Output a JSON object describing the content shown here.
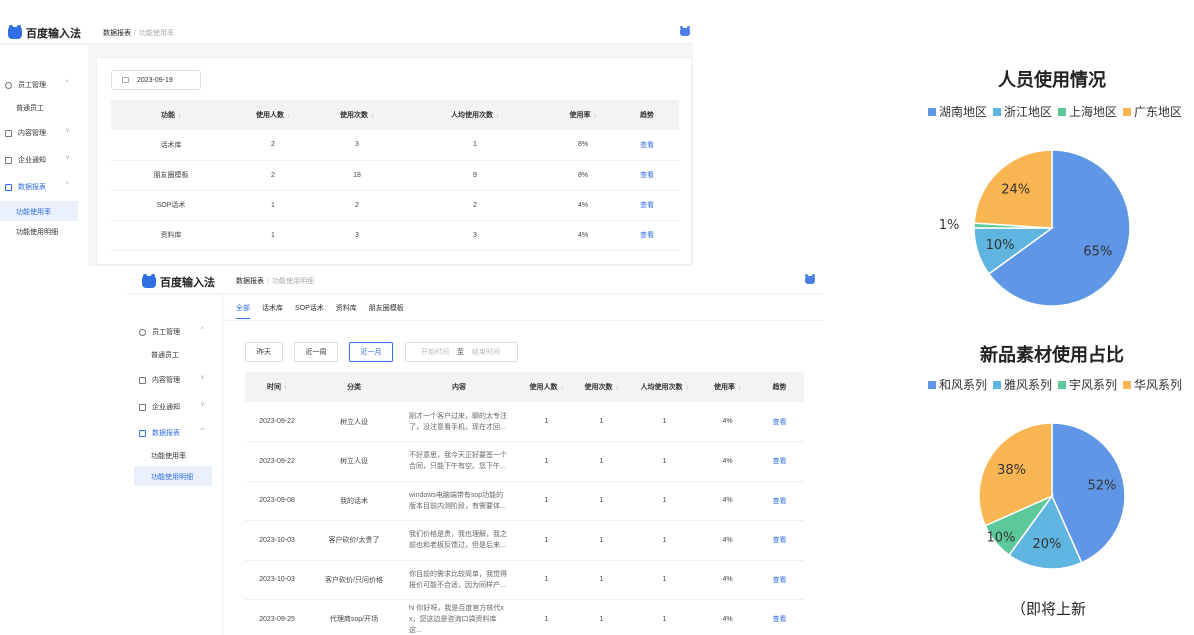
{
  "app": {
    "logo_text": "百度输入法"
  },
  "screen1": {
    "breadcrumb": {
      "parent": "数据报表",
      "separator": "/",
      "current": "功能使用率"
    },
    "sidebar": {
      "items": [
        {
          "label": "员工管理",
          "icon": "user-icon",
          "arrow": "^"
        },
        {
          "label": "内容管理",
          "icon": "document-icon",
          "arrow": "v"
        },
        {
          "label": "企业通知",
          "icon": "notice-icon",
          "arrow": "v"
        },
        {
          "label": "数据报表",
          "icon": "report-icon",
          "arrow": "^"
        }
      ],
      "subitems": [
        "普通员工",
        "功能使用率",
        "功能使用明细"
      ]
    },
    "date": "2023-09-19",
    "table": {
      "headers": [
        "功能",
        "使用人数",
        "使用次数",
        "人均使用次数",
        "使用率",
        "趋势"
      ],
      "rows": [
        [
          "话术库",
          "2",
          "3",
          "1",
          "8%",
          "查看"
        ],
        [
          "朋友圈模板",
          "2",
          "18",
          "9",
          "8%",
          "查看"
        ],
        [
          "SOP话术",
          "1",
          "2",
          "2",
          "4%",
          "查看"
        ],
        [
          "资料库",
          "1",
          "3",
          "3",
          "4%",
          "查看"
        ]
      ]
    }
  },
  "screen2": {
    "breadcrumb": {
      "parent": "数据报表",
      "separator": "/",
      "current": "功能使用明细"
    },
    "tabs": [
      "全部",
      "话术库",
      "SOP话术",
      "资料库",
      "朋友圈模板"
    ],
    "filters": {
      "yesterday": "昨天",
      "week": "近一周",
      "month": "近一月",
      "start_placeholder": "开始时间",
      "to": "至",
      "end_placeholder": "结束时间"
    },
    "table": {
      "headers": [
        "时间",
        "分类",
        "内容",
        "使用人数",
        "使用次数",
        "人均使用次数",
        "使用率",
        "趋势"
      ],
      "rows": [
        [
          "2023-09-22",
          "树立人设",
          "刚才一个客户过来，聊的太专注了，没注意看手机，现在才回...",
          "1",
          "1",
          "1",
          "4%",
          "查看"
        ],
        [
          "2023-09-22",
          "树立人设",
          "不好意思，我今天正好要签一个合同，只能下午有空。您下午...",
          "1",
          "1",
          "1",
          "4%",
          "查看"
        ],
        [
          "2023-09-08",
          "我的话术",
          "windows电脑端带有sop功能的版本目前内测阶段，有需要体...",
          "1",
          "1",
          "1",
          "4%",
          "查看"
        ],
        [
          "2023-10-03",
          "客户砍价/太贵了",
          "我们价格是贵，我也理解，我之前也和老板反馈过，但是后来...",
          "1",
          "1",
          "1",
          "4%",
          "查看"
        ],
        [
          "2023-10-03",
          "客户砍价/只问价格",
          "你目前的需求比较简单，我觉得报价可能不合适，因为同样产...",
          "1",
          "1",
          "1",
          "4%",
          "查看"
        ],
        [
          "2023-09-25",
          "代理商sop/开场",
          "hi 你好呀，我是百度官方核代x x，您这边是咨询口袋资料库这...",
          "1",
          "1",
          "1",
          "4%",
          "查看"
        ]
      ]
    }
  },
  "chart_data": [
    {
      "type": "pie",
      "title": "人员使用情况",
      "categories": [
        "湖南地区",
        "浙江地区",
        "上海地区",
        "广东地区"
      ],
      "values": [
        65,
        10,
        1,
        24
      ],
      "labels": [
        "65%",
        "10%",
        "1%",
        "24%"
      ],
      "colors": [
        "#6096e6",
        "#5fb5e0",
        "#5dc99b",
        "#f9b552"
      ],
      "legend_position": "top"
    },
    {
      "type": "pie",
      "title": "新品素材使用占比",
      "categories": [
        "和风系列",
        "雅风系列",
        "宇风系列",
        "华风系列"
      ],
      "values": [
        52,
        20,
        10,
        38
      ],
      "labels": [
        "52%",
        "20%",
        "10%",
        "38%"
      ],
      "colors": [
        "#6096e6",
        "#5fb5e0",
        "#5dc99b",
        "#f9b552"
      ],
      "legend_position": "top"
    }
  ],
  "footnote": "（即将上新"
}
